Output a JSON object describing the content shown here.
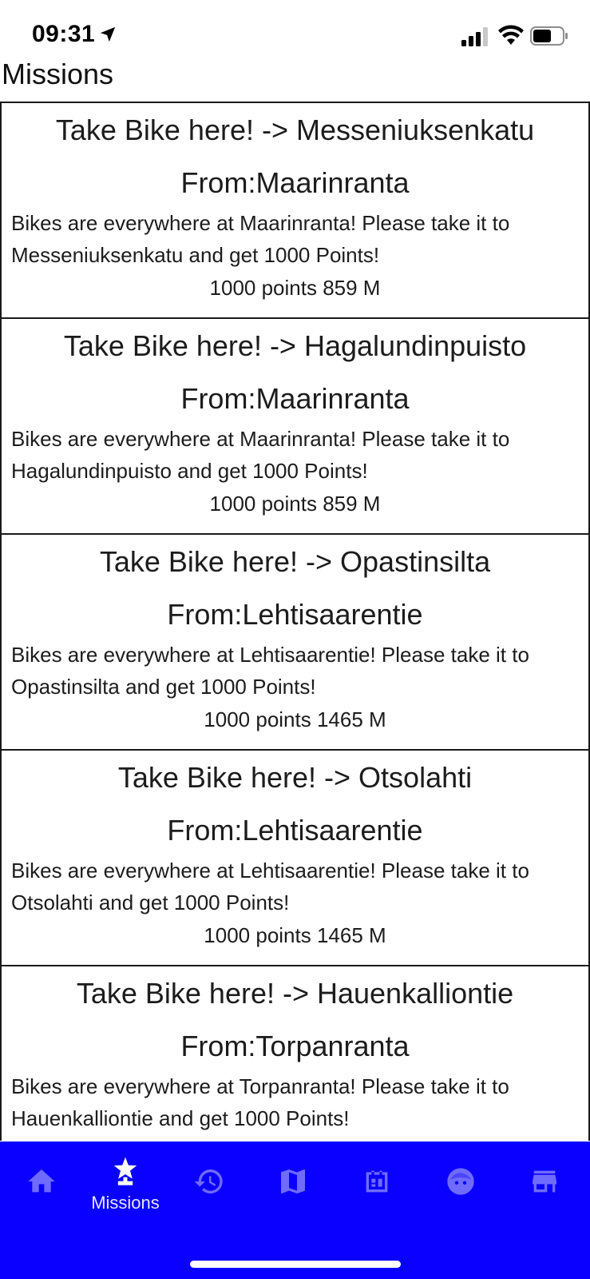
{
  "status_bar": {
    "time": "09:31"
  },
  "page_title": "Missions",
  "missions": [
    {
      "title": "Take Bike here! -> Messeniuksenkatu",
      "from": "From:Maarinranta",
      "description": "Bikes are everywhere at Maarinranta! Please take it to Messeniuksenkatu and get 1000 Points!",
      "meta": "1000 points 859 M"
    },
    {
      "title": "Take Bike here! -> Hagalundinpuisto",
      "from": "From:Maarinranta",
      "description": "Bikes are everywhere at Maarinranta! Please take it to Hagalundinpuisto and get 1000 Points!",
      "meta": "1000 points 859 M"
    },
    {
      "title": "Take Bike here! -> Opastinsilta",
      "from": "From:Lehtisaarentie",
      "description": "Bikes are everywhere at Lehtisaarentie! Please take it to Opastinsilta and get 1000 Points!",
      "meta": "1000 points 1465 M"
    },
    {
      "title": "Take Bike here! -> Otsolahti",
      "from": "From:Lehtisaarentie",
      "description": "Bikes are everywhere at Lehtisaarentie! Please take it to Otsolahti and get 1000 Points!",
      "meta": "1000 points 1465 M"
    },
    {
      "title": "Take Bike here! -> Hauenkalliontie",
      "from": "From:Torpanranta",
      "description": "Bikes are everywhere at Torpanranta! Please take it to Hauenkalliontie and get 1000 Points!",
      "meta": ""
    }
  ],
  "bottom_nav": {
    "items": [
      {
        "icon": "home-icon",
        "label": ""
      },
      {
        "icon": "mission-star-icon",
        "label": "Missions",
        "active": true
      },
      {
        "icon": "history-icon",
        "label": ""
      },
      {
        "icon": "map-icon",
        "label": ""
      },
      {
        "icon": "dashboard-icon",
        "label": ""
      },
      {
        "icon": "profile-face-icon",
        "label": ""
      },
      {
        "icon": "store-icon",
        "label": ""
      }
    ]
  },
  "colors": {
    "nav_background": "#0a00ff",
    "nav_icon": "#6f6bff",
    "nav_active": "#ffffff",
    "card_border": "#1a1a1a"
  }
}
